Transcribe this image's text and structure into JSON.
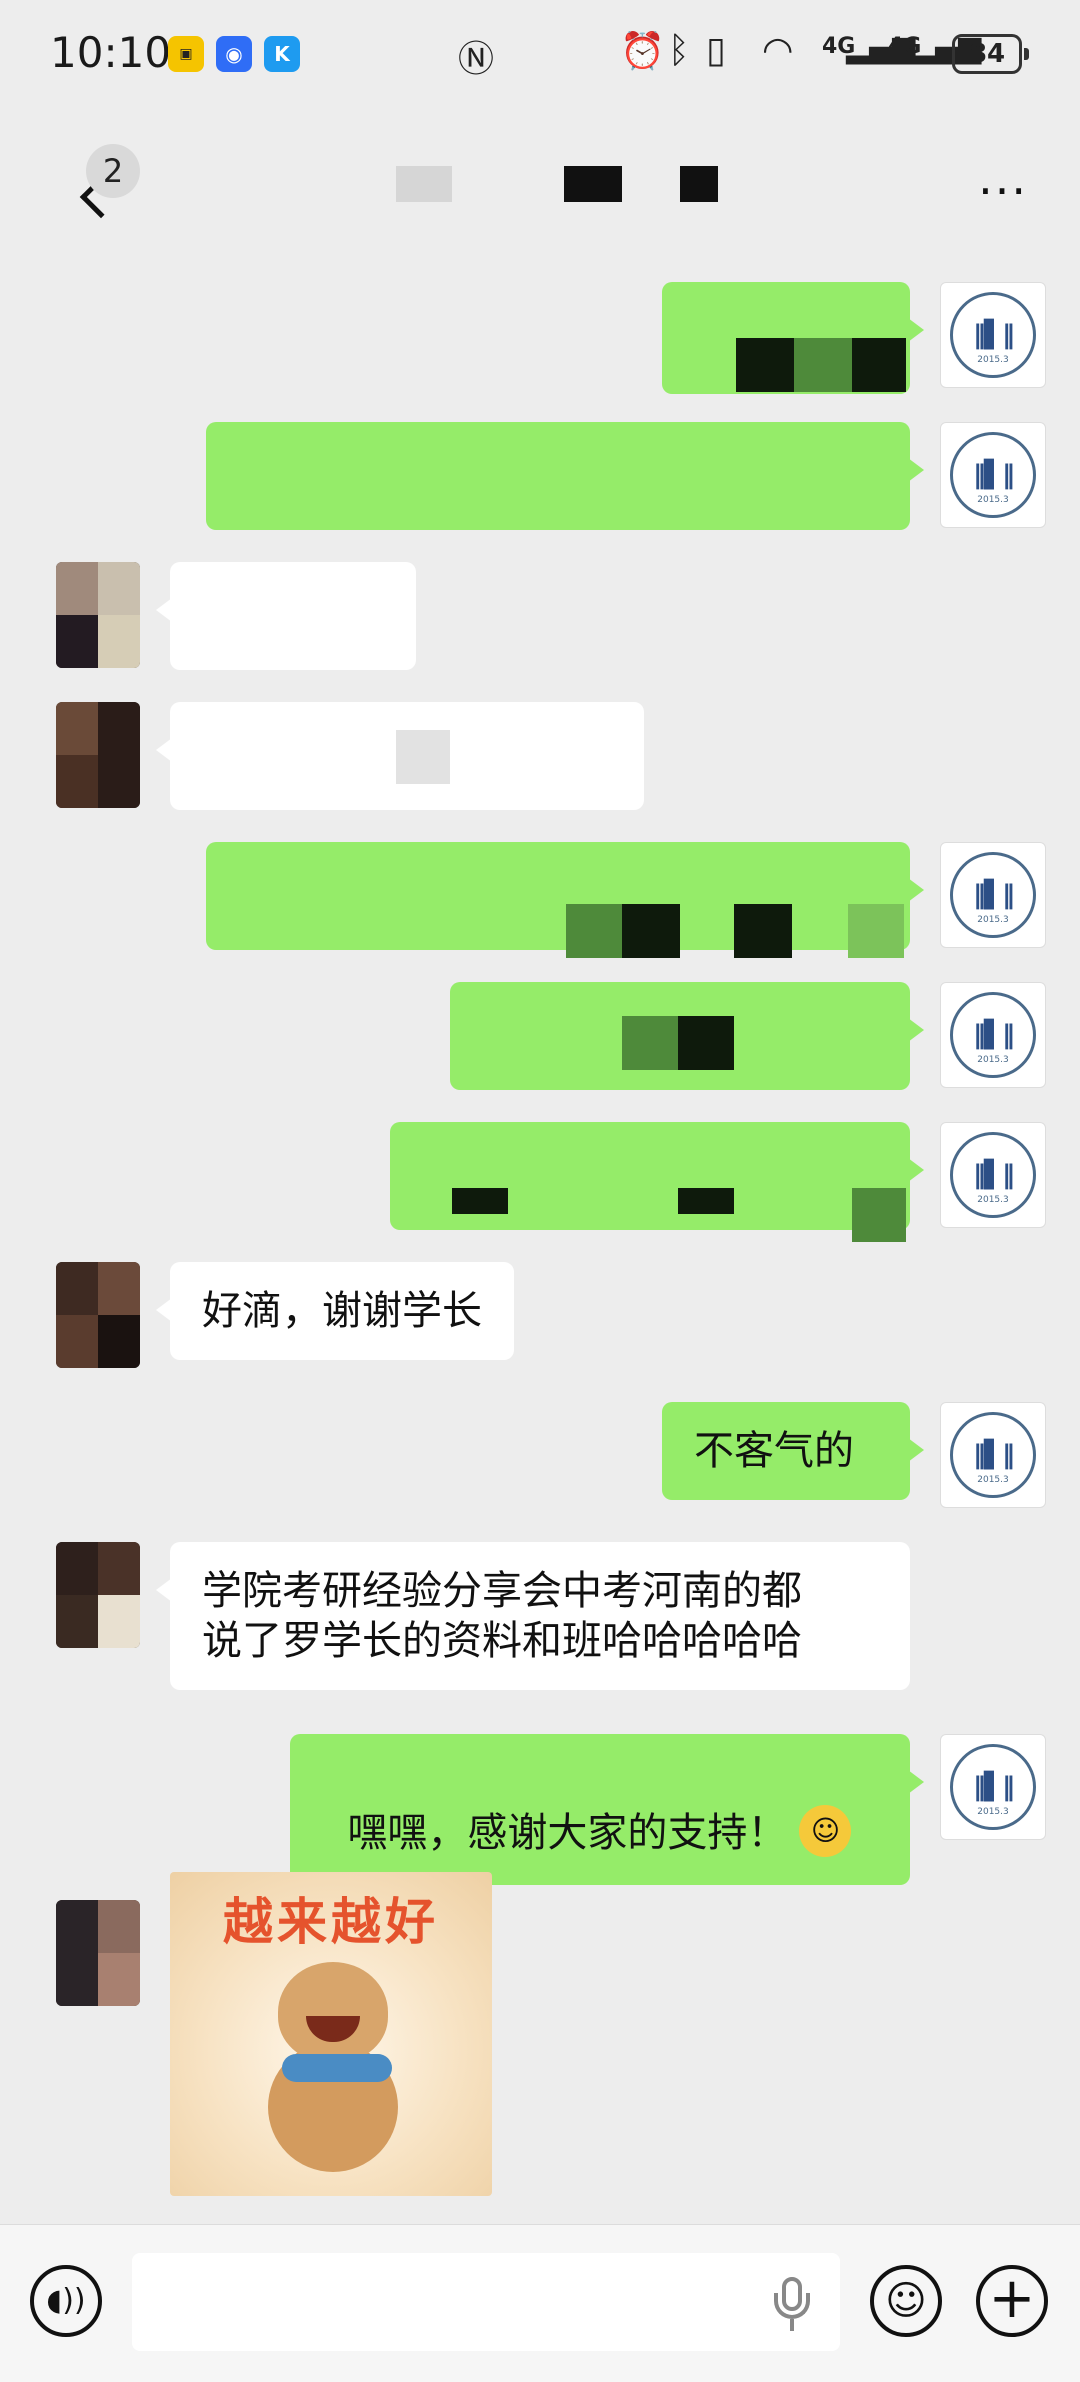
{
  "status_bar": {
    "time": "10:10",
    "network_1": "4G",
    "network_2": "4G",
    "battery": "84"
  },
  "nav": {
    "unread_count": "2",
    "back_icon": "chevron-left-icon",
    "more_icon": "more-dots-icon"
  },
  "messages": {
    "m9": {
      "sender": "other",
      "text": "好滴，谢谢学长"
    },
    "m10": {
      "sender": "self",
      "text": "不客气的"
    },
    "m11": {
      "sender": "other",
      "text": "学院考研经验分享会中考河南的都\n说了罗学长的资料和班哈哈哈哈哈"
    },
    "m12": {
      "sender": "self",
      "text": "嘿嘿，感谢大家的支持！"
    },
    "m13": {
      "sender": "other",
      "type": "sticker",
      "text": "越来越好"
    }
  },
  "self_avatar": {
    "ring_text": "LUO XUE ZHANG KAO YAN",
    "year": "2015.3"
  },
  "input_bar": {
    "placeholder": "",
    "voice_icon": "voice-icon",
    "mic_icon": "mic-icon",
    "emoji_icon": "emoji-icon",
    "plus_icon": "plus-icon"
  },
  "colors": {
    "background": "#ededed",
    "self_bubble": "#95ec69",
    "other_bubble": "#ffffff"
  }
}
